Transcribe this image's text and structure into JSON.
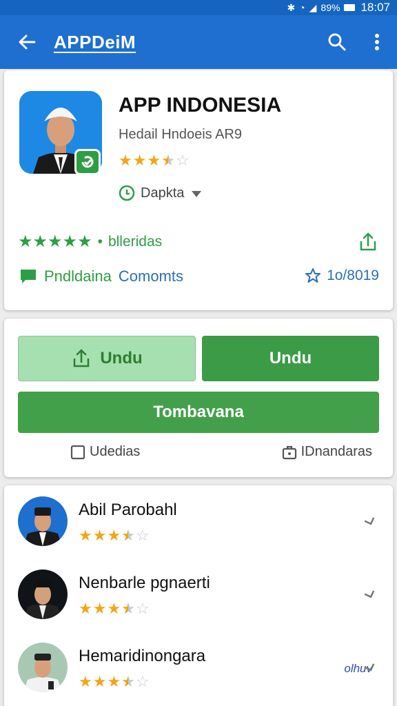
{
  "status_bar": {
    "battery": "89%",
    "time": "18:07"
  },
  "app_bar": {
    "title": "APPDeiM"
  },
  "app": {
    "title": "APP INDONESIA",
    "subtitle": "Hedail Hndoeis AR9",
    "rating": 3.5,
    "install_label": "Dapkta"
  },
  "summary": {
    "stars": 5,
    "stars_label": "blleridas",
    "comments_label_a": "Pndldaina",
    "comments_label_b": "Comomts",
    "rating_count": "1o/8019"
  },
  "actions": {
    "primary_light": "Undu",
    "primary_dark": "Undu",
    "wide": "Tombavana",
    "link_left": "Udedias",
    "link_right": "IDnandaras"
  },
  "reviews": [
    {
      "name": "Abil Parobahl",
      "rating": 3.5
    },
    {
      "name": "Nenbarle pgnaerti",
      "rating": 3.5
    },
    {
      "name": "Hemaridinongara",
      "rating": 3.5,
      "note": "olhuv"
    }
  ],
  "colors": {
    "app_bar": "#1e6fd0",
    "accent_green": "#43a04a",
    "star": "#f2a516"
  }
}
